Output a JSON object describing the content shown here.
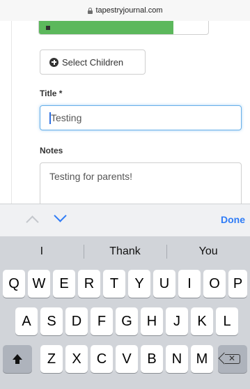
{
  "browser": {
    "url": "tapestryjournal.com"
  },
  "form": {
    "select_children_label": "Select Children",
    "title_label": "Title *",
    "title_value": "Testing",
    "notes_label": "Notes",
    "notes_value": "Testing for parents!"
  },
  "accessory": {
    "done_label": "Done"
  },
  "keyboard": {
    "suggestions": [
      "I",
      "Thank",
      "You"
    ],
    "row1": [
      "Q",
      "W",
      "E",
      "R",
      "T",
      "Y",
      "U",
      "I",
      "O",
      "P"
    ],
    "row2": [
      "A",
      "S",
      "D",
      "F",
      "G",
      "H",
      "J",
      "K",
      "L"
    ],
    "row3": [
      "Z",
      "X",
      "C",
      "V",
      "B",
      "N",
      "M"
    ]
  },
  "colors": {
    "accent": "#2f7cf6",
    "green_button": "#5cb85c",
    "focus_border": "#66afe9"
  }
}
